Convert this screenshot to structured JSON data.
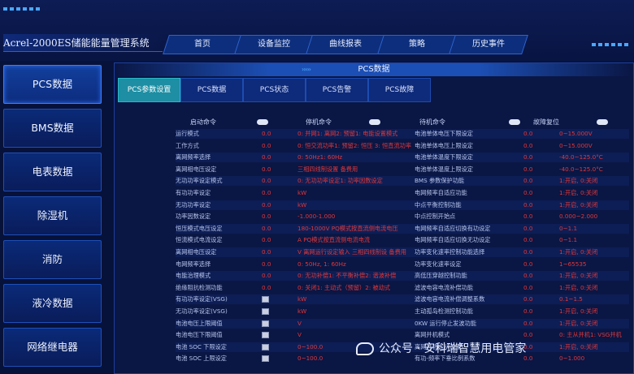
{
  "app_title": "Acrel-2000ES储能能量管理系统",
  "nav": [
    "首页",
    "设备监控",
    "曲线报表",
    "策略",
    "历史事件"
  ],
  "sidebar": [
    "PCS数据",
    "BMS数据",
    "电表数据",
    "除湿机",
    "消防",
    "液冷数据",
    "网络继电器"
  ],
  "panel_title": "PCS数据",
  "panel_arrows": "›››››",
  "subtabs": [
    "PCS参数设置",
    "PCS数据",
    "PCS状态",
    "PCS告警",
    "PCS故障"
  ],
  "column_headers": [
    "启动命令",
    "停机命令",
    "待机命令",
    "故障复位"
  ],
  "left_rows": [
    {
      "label": "运行模式",
      "v1": "0.0",
      "v2": "0: 并网1: 离网2: 预留1: 电能设置模式"
    },
    {
      "label": "工作方式",
      "v1": "0.0",
      "v2": "0: 恒交流功率1: 预留2: 恒压 3: 恒直流功率"
    },
    {
      "label": "离网频率选择",
      "v1": "0.0",
      "v2": "0: 50Hz1: 60Hz"
    },
    {
      "label": "离网相电压设定",
      "v1": "0.0",
      "v2": "三相四线制设置 备费用"
    },
    {
      "label": "无功功率设定模式",
      "v1": "0.0",
      "v2": "0: 无功功率设定1: 功率因数设定"
    },
    {
      "label": "有功功率设定",
      "v1": "0.0",
      "v2": "kW"
    },
    {
      "label": "无功功率设定",
      "v1": "0.0",
      "v2": "kW"
    },
    {
      "label": "功率因数设定",
      "v1": "0.0",
      "v2": "-1.000-1.000"
    },
    {
      "label": "恒压模式电压设定",
      "v1": "0.0",
      "v2": "180-1000V PQ模式按直流侧电流电压"
    },
    {
      "label": "恒流模式电流设定",
      "v1": "0.0",
      "v2": "A    PQ模式按直流侧电流电流"
    },
    {
      "label": "离网相电压设定",
      "v1": "0.0",
      "v2": "V 离网运行设定输入 三相四线制设 备费用"
    },
    {
      "label": "电网频率选择",
      "v1": "0.0",
      "v2": "0: 50Hz, 1: 60Hz"
    },
    {
      "label": "电能治理模式",
      "v1": "0.0",
      "v2": "0: 无功补偿1: 不平衡补偿2: 谐波补偿"
    },
    {
      "label": "绝缘阻抗检测功能",
      "v1": "0.0",
      "v2": "0: 关闭1: 主动式（预留）2: 被动式"
    },
    {
      "label": "有功功率设定(VSG)",
      "v1": "",
      "v2": "kW"
    },
    {
      "label": "无功功率设定(VSG)",
      "v1": "",
      "v2": "kW"
    },
    {
      "label": "电池电压上限阈值",
      "v1": "",
      "v2": "V"
    },
    {
      "label": "电池电压下限阈值",
      "v1": "",
      "v2": "V"
    },
    {
      "label": "电池 SOC 下限设定",
      "v1": "",
      "v2": "0~100.0"
    },
    {
      "label": "电池 SOC 上限设定",
      "v1": "",
      "v2": "0~100.0"
    }
  ],
  "right_rows": [
    {
      "label": "电池单体电压下限设定",
      "v1": "0.0",
      "v2": "0~15.000V"
    },
    {
      "label": "电池单体电压上限设定",
      "v1": "0.0",
      "v2": "0~15.000V"
    },
    {
      "label": "电池单体温度下限设定",
      "v1": "0.0",
      "v2": "-40.0~125.0°C"
    },
    {
      "label": "电池单体温度上限设定",
      "v1": "0.0",
      "v2": "-40.0~125.0°C"
    },
    {
      "label": "BMS 参数保护功能",
      "v1": "0.0",
      "v2": "1:开启, 0:关闭"
    },
    {
      "label": "电网频率自适应功能",
      "v1": "0.0",
      "v2": "1:开启, 0:关闭"
    },
    {
      "label": "中点平衡控制功能",
      "v1": "0.0",
      "v2": "1:开启, 0:关闭"
    },
    {
      "label": "中点控制开始点",
      "v1": "0.0",
      "v2": "0.000~2.000"
    },
    {
      "label": "电网频率自适应切换有功设定",
      "v1": "0.0",
      "v2": "0~1.1"
    },
    {
      "label": "电网频率自适应切换无功设定",
      "v1": "0.0",
      "v2": "0~1.1"
    },
    {
      "label": "功率变化速率控制功能选择",
      "v1": "0.0",
      "v2": "1:开启, 0:关闭"
    },
    {
      "label": "功率变化速率设定",
      "v1": "0.0",
      "v2": "1~65535"
    },
    {
      "label": "高低压穿越控制功能",
      "v1": "0.0",
      "v2": "1:开启, 0:关闭"
    },
    {
      "label": "滤波电容电流补偿功能",
      "v1": "0.0",
      "v2": "1:开启, 0:关闭"
    },
    {
      "label": "滤波电容电流补偿调整系数",
      "v1": "0.0",
      "v2": "0.1~1.5"
    },
    {
      "label": "主动孤岛检测控制功能",
      "v1": "0.0",
      "v2": "1:开启, 0:关闭"
    },
    {
      "label": "0KW 运行停止发波功能",
      "v1": "0.0",
      "v2": "1:开启, 0:关闭"
    },
    {
      "label": "离网并机模式",
      "v1": "0.0",
      "v2": "0: 主从并机1: VSG并机"
    },
    {
      "label": "离网并机主从设置",
      "v1": "0.0",
      "v2": "1:开启, 0:关闭"
    },
    {
      "label": "有功-频率下垂比例系数",
      "v1": "0.0",
      "v2": "0~1.000"
    }
  ],
  "watermark": "公众号 · 安科瑞智慧用电管家",
  "colors": {
    "accent": "#1d8ea3",
    "value_red": "#e0383a",
    "bg": "#07123a",
    "panel": "#0a1644",
    "nav_border": "#2f63cf"
  }
}
